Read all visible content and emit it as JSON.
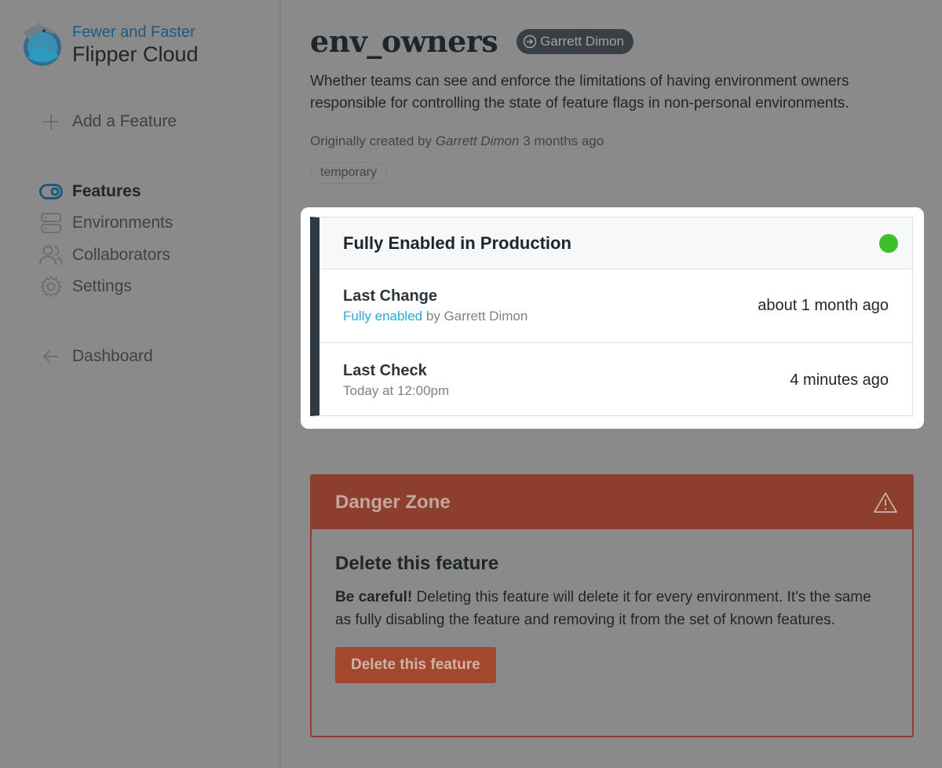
{
  "brand": {
    "tagline": "Fewer and Faster",
    "name": "Flipper Cloud"
  },
  "nav": {
    "add_feature": "Add a Feature",
    "features": "Features",
    "environments": "Environments",
    "collaborators": "Collaborators",
    "settings": "Settings",
    "dashboard": "Dashboard"
  },
  "feature": {
    "key": "env_owners",
    "owner": "Garrett Dimon",
    "description": "Whether teams can see and enforce the limitations of having environment owners responsible for controlling the state of feature flags in non-personal environments.",
    "created_prefix": "Originally created by",
    "created_by": "Garrett Dimon",
    "created_when": "3 months ago",
    "tag": "temporary"
  },
  "status_card": {
    "title": "Fully Enabled in Production",
    "status_color": "#3fbf2b",
    "last_change_label": "Last Change",
    "last_change_action": "Fully enabled",
    "last_change_by": "by Garrett Dimon",
    "last_change_when": "about 1 month ago",
    "last_check_label": "Last Check",
    "last_check_time": "Today at 12:00pm",
    "last_check_when": "4 minutes ago"
  },
  "danger": {
    "title": "Danger Zone",
    "heading": "Delete this feature",
    "warning_bold": "Be careful!",
    "warning_text": " Deleting this feature will delete it for every environment. It's the same as fully disabling the feature and removing it from the set of known features.",
    "button": "Delete this feature"
  }
}
